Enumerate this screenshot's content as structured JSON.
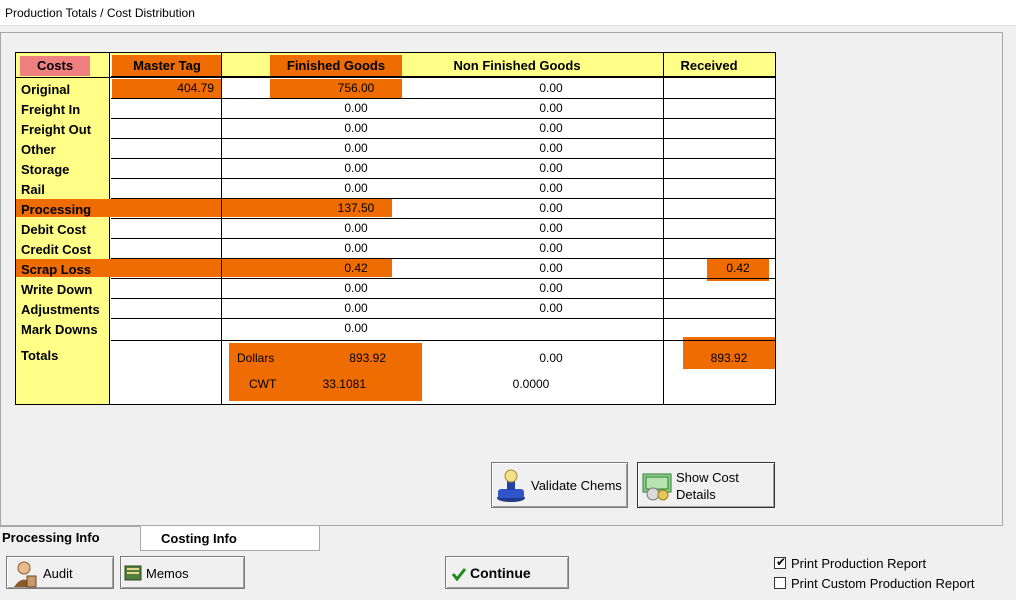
{
  "window": {
    "title": "Production Totals / Cost Distribution"
  },
  "table": {
    "headers": {
      "costs": "Costs",
      "master_tag": "Master Tag",
      "finished_goods": "Finished Goods",
      "non_finished_goods": "Non Finished Goods",
      "received": "Received"
    },
    "rows": [
      {
        "label": "Original",
        "master_tag": "404.79",
        "fg": "756.00",
        "nfg": "0.00",
        "received": ""
      },
      {
        "label": "Freight In",
        "master_tag": "",
        "fg": "0.00",
        "nfg": "0.00",
        "received": ""
      },
      {
        "label": "Freight Out",
        "master_tag": "",
        "fg": "0.00",
        "nfg": "0.00",
        "received": ""
      },
      {
        "label": "Other",
        "master_tag": "",
        "fg": "0.00",
        "nfg": "0.00",
        "received": ""
      },
      {
        "label": "Storage",
        "master_tag": "",
        "fg": "0.00",
        "nfg": "0.00",
        "received": ""
      },
      {
        "label": "Rail",
        "master_tag": "",
        "fg": "0.00",
        "nfg": "0.00",
        "received": ""
      },
      {
        "label": "Processing",
        "master_tag": "",
        "fg": "137.50",
        "nfg": "0.00",
        "received": ""
      },
      {
        "label": "Debit Cost",
        "master_tag": "",
        "fg": "0.00",
        "nfg": "0.00",
        "received": ""
      },
      {
        "label": "Credit Cost",
        "master_tag": "",
        "fg": "0.00",
        "nfg": "0.00",
        "received": ""
      },
      {
        "label": "Scrap Loss",
        "master_tag": "",
        "fg": "0.42",
        "nfg": "0.00",
        "received": "0.42"
      },
      {
        "label": "Write Down",
        "master_tag": "",
        "fg": "0.00",
        "nfg": "0.00",
        "received": ""
      },
      {
        "label": "Adjustments",
        "master_tag": "",
        "fg": "0.00",
        "nfg": "0.00",
        "received": ""
      },
      {
        "label": "Mark Downs",
        "master_tag": "",
        "fg": "0.00",
        "nfg": "",
        "received": ""
      }
    ],
    "totals": {
      "label": "Totals",
      "dollars_label": "Dollars",
      "dollars_fg": "893.92",
      "dollars_nfg": "0.00",
      "dollars_received": "893.92",
      "cwt_label": "CWT",
      "cwt_fg": "33.1081",
      "cwt_nfg": "0.0000"
    }
  },
  "buttons": {
    "validate_chems": "Validate Chems",
    "show_cost_details_1": "Show Cost",
    "show_cost_details_2": "Details",
    "audit": "Audit",
    "memos": "Memos",
    "continue": "Continue"
  },
  "tabs": [
    {
      "label": "Processing Info",
      "active": false
    },
    {
      "label": "Costing Info",
      "active": true
    }
  ],
  "checkboxes": [
    {
      "label": "Print Production Report",
      "checked": true
    },
    {
      "label": "Print Custom Production Report",
      "checked": false
    }
  ],
  "colors": {
    "highlight": "#ee6c00",
    "header": "#ffff88",
    "costs_header": "#f08080"
  },
  "icons": {
    "validate_chems": "stamp-icon",
    "show_cost_details": "money-icon",
    "audit": "auditor-icon",
    "memos": "memo-book-icon",
    "continue": "checkmark-icon"
  }
}
